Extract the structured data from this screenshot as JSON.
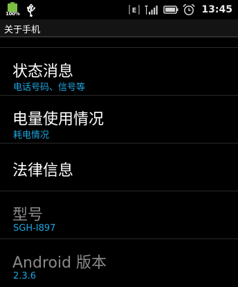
{
  "status_bar": {
    "battery_label": "100%",
    "network_type": "E",
    "time": "13:45"
  },
  "title": "关于手机",
  "items": [
    {
      "title": "状态消息",
      "subtitle": "电话号码、信号等"
    },
    {
      "title": "电量使用情况",
      "subtitle": "耗电情况"
    },
    {
      "title": "法律信息"
    },
    {
      "title": "型号",
      "subtitle": "SGH-I897"
    },
    {
      "title": "Android 版本",
      "subtitle": "2.3.6"
    }
  ]
}
